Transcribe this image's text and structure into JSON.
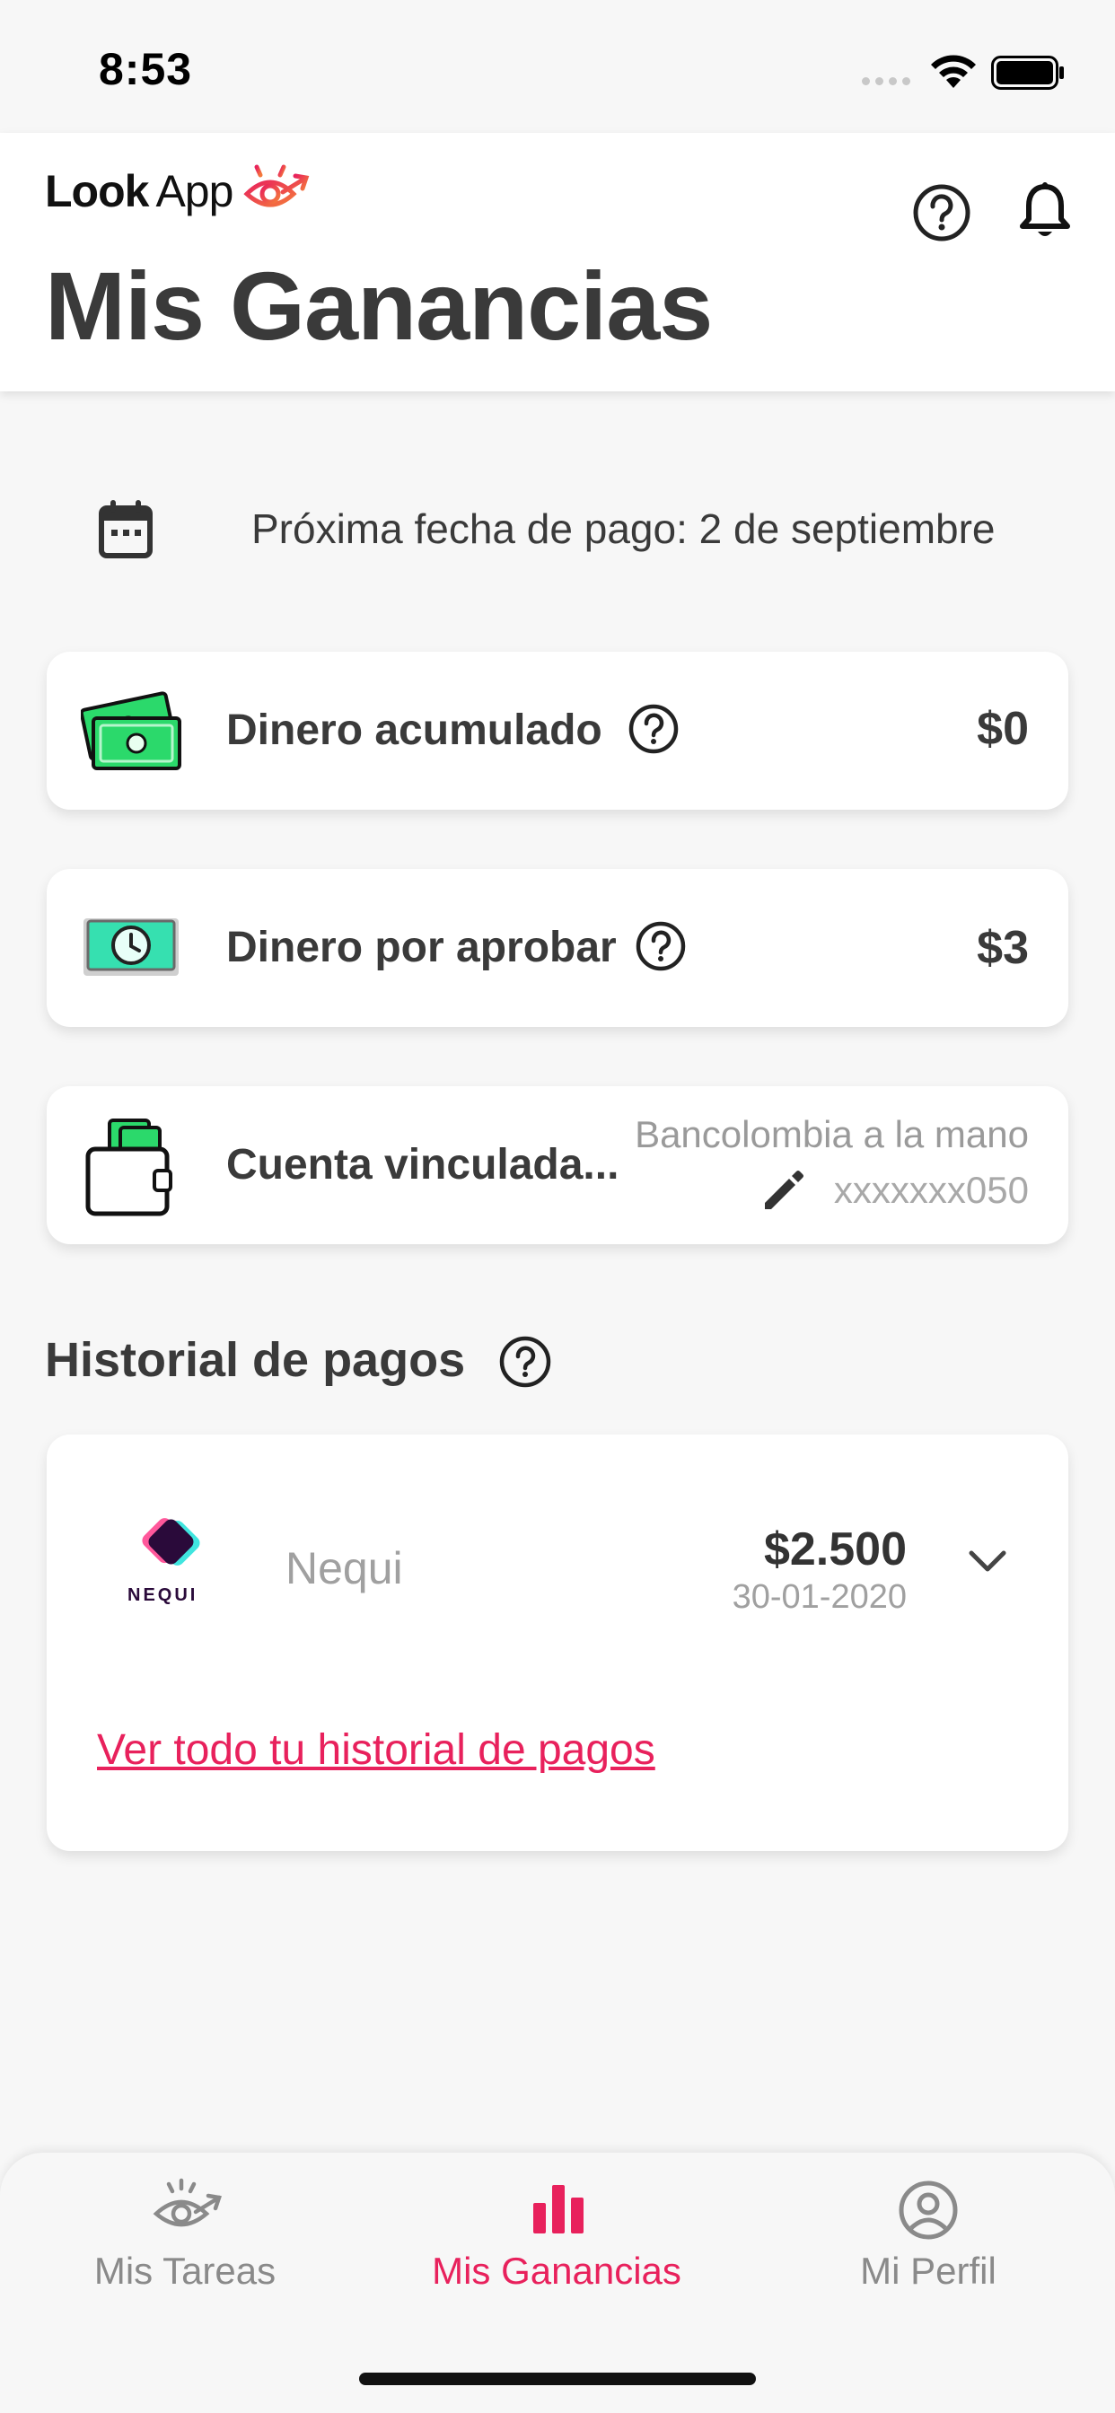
{
  "status_bar": {
    "time": "8:53"
  },
  "header": {
    "logo_bold": "Look",
    "logo_light": "App",
    "title": "Mis Ganancias"
  },
  "next_payment": {
    "text": "Próxima fecha de pago: 2 de septiembre"
  },
  "cards": {
    "accumulated": {
      "label": "Dinero acumulado",
      "value": "$0"
    },
    "pending": {
      "label": "Dinero por aprobar",
      "value": "$3"
    },
    "linked_account": {
      "label": "Cuenta vinculada...",
      "bank": "Bancolombia a la mano",
      "account": "xxxxxxx050"
    }
  },
  "history": {
    "title": "Historial de pagos",
    "items": [
      {
        "logo_text": "NEQUI",
        "name": "Nequi",
        "amount": "$2.500",
        "date": "30-01-2020"
      }
    ],
    "see_all": "Ver todo tu historial de pagos"
  },
  "tabbar": {
    "tabs": [
      {
        "label": "Mis Tareas",
        "icon": "eye-icon",
        "active": false
      },
      {
        "label": "Mis Ganancias",
        "icon": "bar-chart-icon",
        "active": true
      },
      {
        "label": "Mi Perfil",
        "icon": "profile-icon",
        "active": false
      }
    ]
  },
  "colors": {
    "accent": "#e8215c",
    "money_green": "#2bd96b",
    "dark_text": "#3a3a3a",
    "muted_text": "#a0a0a0",
    "background": "#f7f7f7"
  }
}
